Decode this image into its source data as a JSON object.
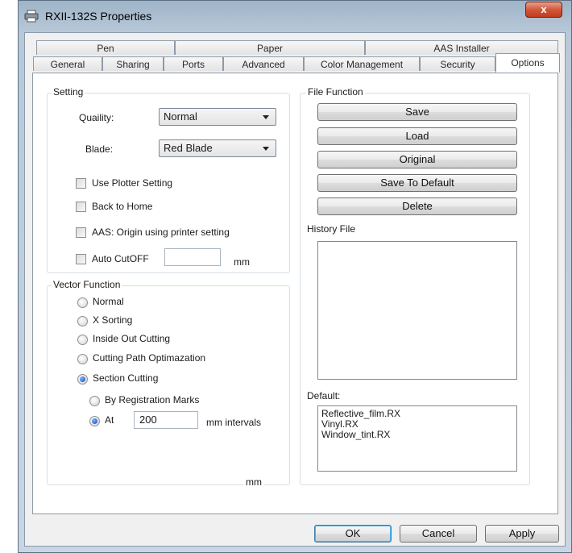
{
  "window": {
    "title": "RXII-132S Properties",
    "close_label": "x"
  },
  "tabs_row1": [
    "Pen",
    "Paper",
    "AAS Installer"
  ],
  "tabs_row2": [
    "General",
    "Sharing",
    "Ports",
    "Advanced",
    "Color Management",
    "Security",
    "Options"
  ],
  "active_tab": "Options",
  "setting": {
    "group_label": "Setting",
    "quality_label": "Quaility:",
    "quality_value": "Normal",
    "blade_label": "Blade:",
    "blade_value": "Red  Blade",
    "use_plotter": "Use Plotter Setting",
    "back_home": "Back to Home",
    "aas_origin": "AAS: Origin using printer setting",
    "auto_cutoff": "Auto CutOFF",
    "auto_cutoff_unit": "mm"
  },
  "vector": {
    "group_label": "Vector Function",
    "options": [
      "Normal",
      "X Sorting",
      "Inside Out Cutting",
      "Cutting Path Optimazation",
      "Section Cutting"
    ],
    "by_registration": "By Registration Marks",
    "at_label": "At",
    "at_value": "200",
    "intervals_label": "mm intervals",
    "bottom_unit": "mm"
  },
  "file_function": {
    "group_label": "File Function",
    "buttons": [
      "Save",
      "Load",
      "Original",
      "Save To Default",
      "Delete"
    ],
    "history_label": "History File",
    "default_label": "Default:",
    "default_files": [
      "Reflective_film.RX",
      "Vinyl.RX",
      "Window_tint.RX"
    ]
  },
  "footer": {
    "ok": "OK",
    "cancel": "Cancel",
    "apply": "Apply"
  }
}
